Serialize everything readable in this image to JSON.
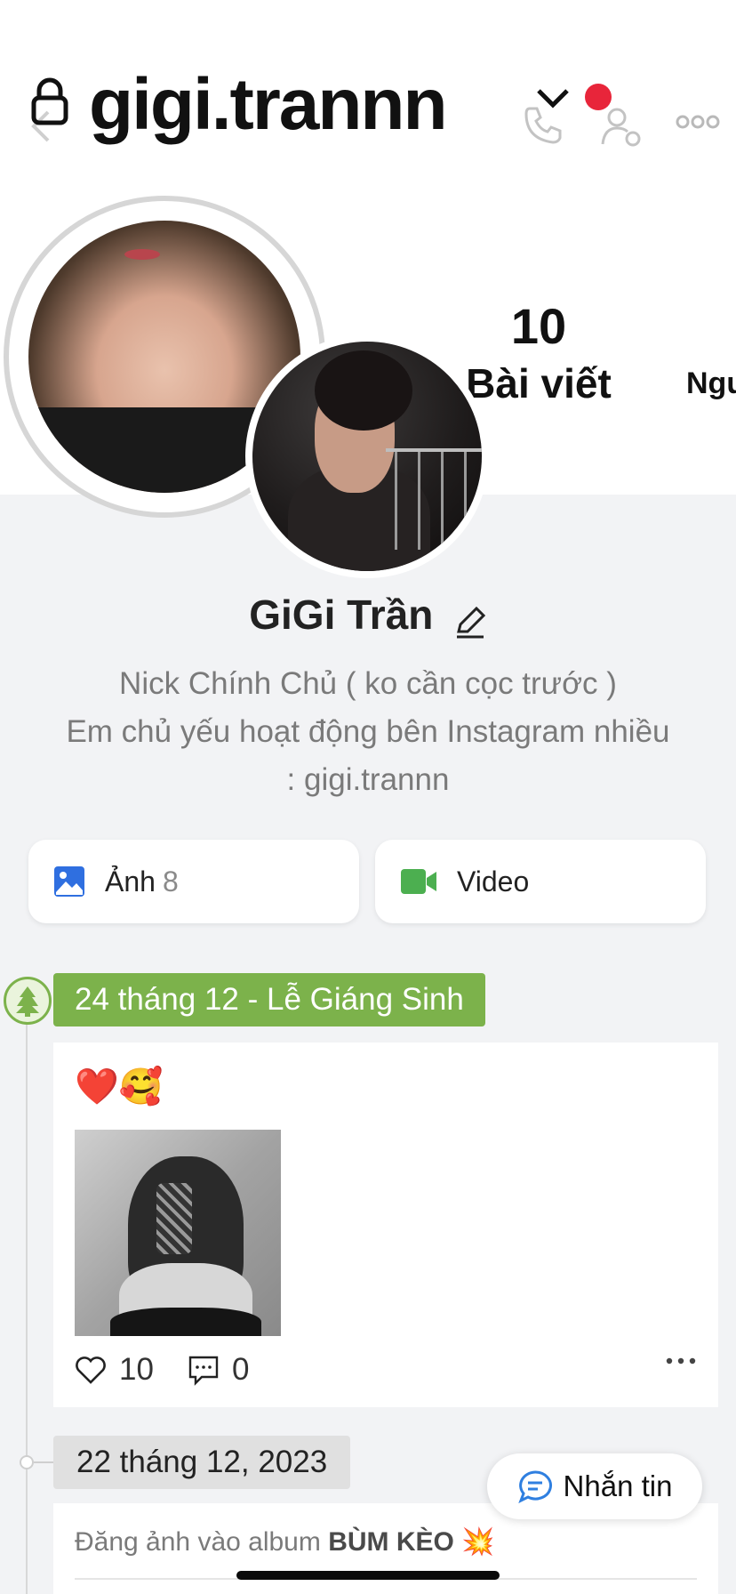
{
  "header": {
    "username": "gigi.trannn",
    "icons": [
      "lock-icon",
      "chevron-down-icon",
      "notification-dot",
      "back-icon",
      "phone-icon",
      "user-settings-icon",
      "more-icon"
    ]
  },
  "stats": {
    "posts_count": "10",
    "posts_label": "Bài viết",
    "followers_label": "Ngư"
  },
  "profile": {
    "name": "GiGi Trần",
    "bio_lines": [
      "Nick Chính Chủ ( ko cần cọc trước )",
      "Em chủ yếu hoạt động bên Instagram nhiều",
      ": gigi.trannn"
    ]
  },
  "media": {
    "photos_label": "Ảnh",
    "photos_count": "8",
    "videos_label": "Video"
  },
  "timeline": {
    "event_label": "24 tháng 12 - Lễ Giáng Sinh",
    "post1": {
      "emoji": "❤️🥰",
      "likes": "10",
      "comments": "0"
    },
    "date_label": "22 tháng 12, 2023",
    "post2": {
      "text_prefix": "Đăng ảnh vào album",
      "album": "BÙM KÈO",
      "emoji": "💥"
    }
  },
  "message_button": {
    "label": "Nhắn tin"
  },
  "colors": {
    "accent_green": "#7cb24b",
    "notification_red": "#e8253a",
    "message_blue": "#2f7fe0",
    "video_green": "#4caf50"
  }
}
